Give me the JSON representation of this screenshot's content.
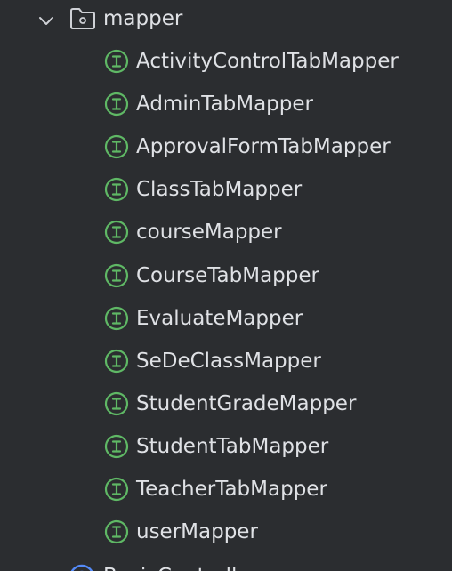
{
  "folder": {
    "label": "mapper",
    "icon": "folder-icon",
    "expanded_icon": "chevron-down-icon"
  },
  "items": [
    {
      "label": "ActivityControlTabMapper",
      "icon": "interface-icon"
    },
    {
      "label": "AdminTabMapper",
      "icon": "interface-icon"
    },
    {
      "label": "ApprovalFormTabMapper",
      "icon": "interface-icon"
    },
    {
      "label": "ClassTabMapper",
      "icon": "interface-icon"
    },
    {
      "label": "courseMapper",
      "icon": "interface-icon"
    },
    {
      "label": "CourseTabMapper",
      "icon": "interface-icon"
    },
    {
      "label": "EvaluateMapper",
      "icon": "interface-icon"
    },
    {
      "label": "SeDeClassMapper",
      "icon": "interface-icon"
    },
    {
      "label": "StudentGradeMapper",
      "icon": "interface-icon"
    },
    {
      "label": "StudentTabMapper",
      "icon": "interface-icon"
    },
    {
      "label": "TeacherTabMapper",
      "icon": "interface-icon"
    },
    {
      "label": "userMapper",
      "icon": "interface-icon"
    }
  ],
  "next_item": {
    "label": "BasicController",
    "icon": "class-icon"
  },
  "colors": {
    "background": "#2b2d30",
    "text": "#dfe1e5",
    "interface_icon": "#5fb865",
    "class_icon": "#548af7",
    "chevron": "#cfd1d6"
  }
}
